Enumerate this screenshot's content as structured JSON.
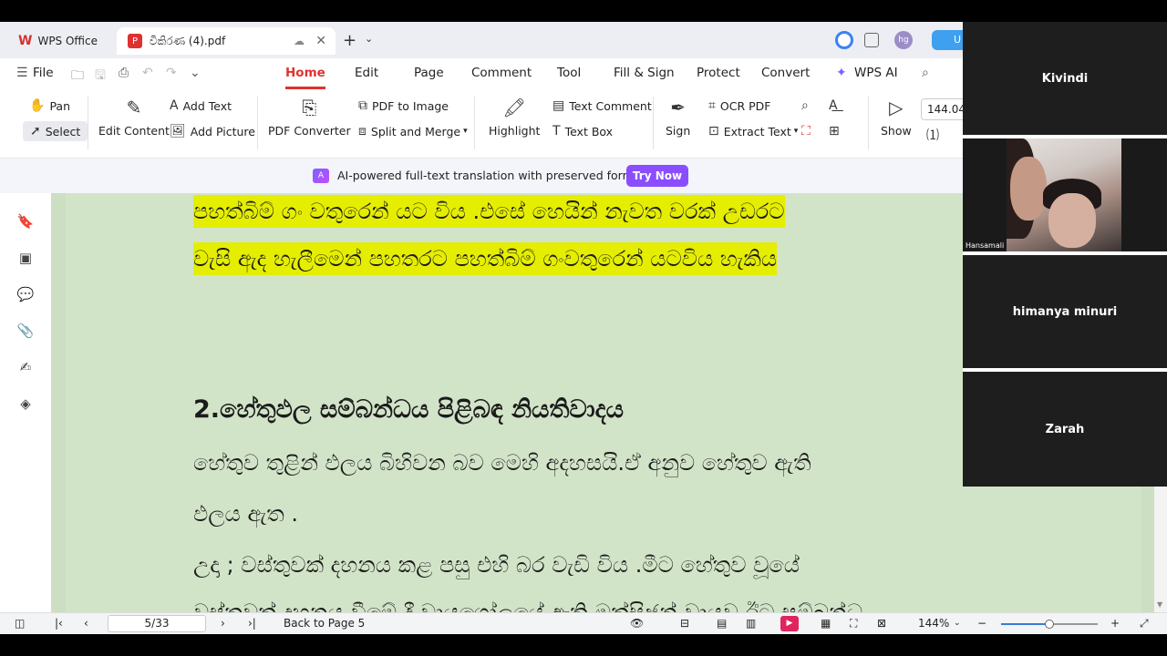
{
  "tabs": {
    "home_label": "WPS Office",
    "doc_label": "විකිරණ (4).pdf"
  },
  "avatar_initials": "hg",
  "upgrade_label": "U",
  "menu": {
    "file": "File",
    "items": [
      "Home",
      "Edit",
      "Page",
      "Comment",
      "Tool",
      "Fill & Sign",
      "Protect",
      "Convert",
      "WPS AI"
    ]
  },
  "ribbon": {
    "pan": "Pan",
    "select": "Select",
    "edit_content": "Edit Content",
    "add_text": "Add Text",
    "add_picture": "Add Picture",
    "pdf_to_image": "PDF to Image",
    "pdf_converter": "PDF Converter",
    "split_merge": "Split and Merge",
    "highlight": "Highlight",
    "text_comment": "Text Comment",
    "text_box": "Text Box",
    "sign": "Sign",
    "ocr_pdf": "OCR PDF",
    "extract_text": "Extract Text",
    "show": "Show",
    "zoom_value": "144.04"
  },
  "banner": {
    "text": "AI-powered full-text translation with preserved formatting.",
    "button": "Try Now"
  },
  "document": {
    "lines": [
      "පහත්බිම් ගං වතුරෙන් යට විය .එසේ  හෙයින් නැවත වරක් උඩරට",
      "වැසි ඇද හැලීමෙන්  පහතරට පහත්බිම් ගංවතුරෙන් යටවිය හැකිය",
      "2.හේතුඵල සම්බන්ධය පිළිබඳ නියතිවාදය",
      "හේතුව තුළින් ඵලය බිහිවන බව මෙහි අදහසයි.ඒ අනුව හේතුව ඇති",
      "ඵලය ඇත .",
      "උදා ;  වස්තුවක් දහනය කළ පසු එහි බර වැඩි විය .මීට හේතුව වූයේ",
      "වස්තුවක් දහනය වීමේ දී වායුගෝලයේ ඇති ඔක්සිජන් වායුව ඊට සම්බන්ධ"
    ]
  },
  "status": {
    "page_input": "5/33",
    "back_to_page": "Back to Page 5",
    "zoom": "144%",
    "zoom_fraction": 0.5
  },
  "participants": [
    {
      "name": "Kivindi",
      "video": false
    },
    {
      "name": "Hansamali",
      "video": true
    },
    {
      "name": "himanya minuri",
      "video": false
    },
    {
      "name": "Zarah",
      "video": false
    }
  ],
  "colors": {
    "accent": "#e03131",
    "highlight": "#e5ee00",
    "page_bg": "#d2e4c8",
    "try_now": "#8a4dff"
  }
}
